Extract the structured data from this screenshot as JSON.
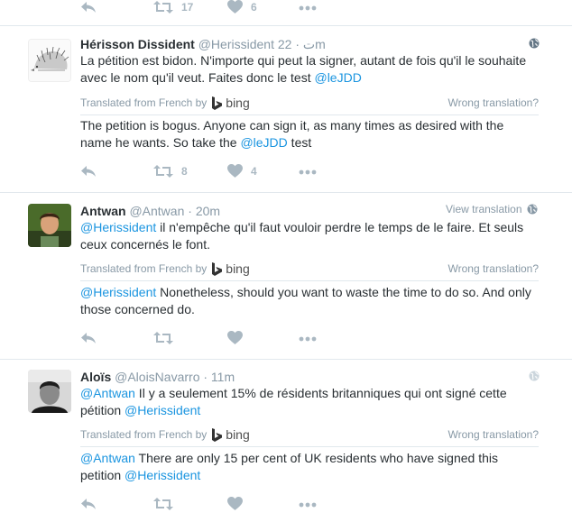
{
  "top_actions": {
    "retweet_count": "17",
    "like_count": "6"
  },
  "tweets": [
    {
      "name": "Hérisson Dissident",
      "handle": "@Herissident",
      "handle_suffix": "ت",
      "time": "· 22m",
      "text_pre": "La pétition est bidon. N'importe qui peut la signer, autant de fois qu'il le souhaite avec le nom qu'il veut. Faites donc le test ",
      "text_mention": "@leJDD",
      "translated_by": "Translated from French by",
      "bing": "bing",
      "wrong": "Wrong translation?",
      "trans_pre": "The petition is bogus. Anyone can sign it, as many times as desired with the name he wants. So take the ",
      "trans_mention": "@leJDD",
      "trans_post": " test",
      "retweet_count": "8",
      "like_count": "4"
    },
    {
      "name": "Antwan",
      "handle": "@Antwan",
      "time": "· 20m",
      "view_translation": "View translation",
      "text_mention": "@Herissident",
      "text_post": " il n'empêche qu'il faut vouloir perdre le temps de le faire. Et seuls ceux concernés le font.",
      "translated_by": "Translated from French by",
      "bing": "bing",
      "wrong": "Wrong translation?",
      "trans_mention": "@Herissident",
      "trans_post": " Nonetheless, should you want to waste the time to do so. And only those concerned do."
    },
    {
      "name": "Aloïs",
      "handle": "@AloisNavarro",
      "time": "· 11m",
      "text_mention1": "@Antwan",
      "text_mid": " Il y a seulement 15% de résidents britanniques qui ont signé cette pétition ",
      "text_mention2": "@Herissident",
      "translated_by": "Translated from French by",
      "bing": "bing",
      "wrong": "Wrong translation?",
      "trans_mention1": "@Antwan",
      "trans_mid": " There are only 15 per cent of UK residents who have signed this petition ",
      "trans_mention2": "@Herissident"
    }
  ]
}
